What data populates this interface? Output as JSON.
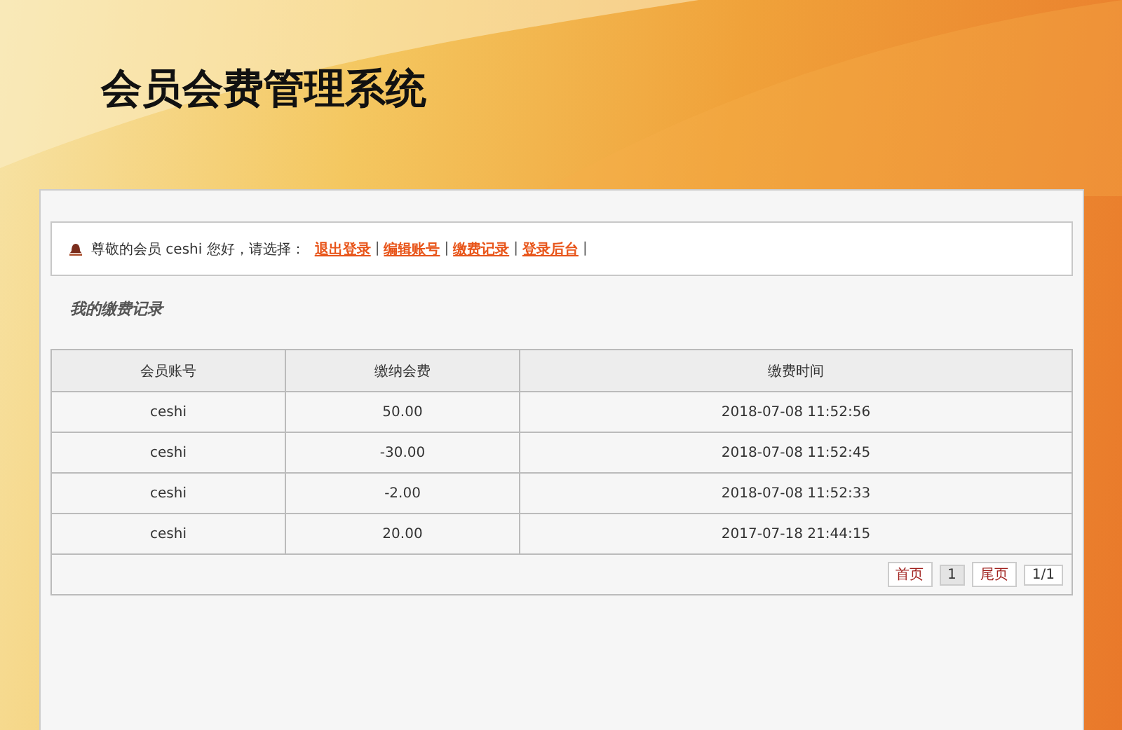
{
  "header": {
    "title": "会员会费管理系统"
  },
  "notice": {
    "greeting": "尊敬的会员 ceshi 您好，请选择：",
    "separator": "|",
    "links": [
      "退出登录",
      "编辑账号",
      "缴费记录",
      "登录后台"
    ]
  },
  "section_title": "我的缴费记录",
  "table": {
    "columns": [
      "会员账号",
      "缴纳会费",
      "缴费时间"
    ],
    "rows": [
      [
        "ceshi",
        "50.00",
        "2018-07-08 11:52:56"
      ],
      [
        "ceshi",
        "-30.00",
        "2018-07-08 11:52:45"
      ],
      [
        "ceshi",
        "-2.00",
        "2018-07-08 11:52:33"
      ],
      [
        "ceshi",
        "20.00",
        "2017-07-18 21:44:15"
      ]
    ]
  },
  "pager": [
    {
      "label": "首页",
      "kind": "link",
      "selected": false
    },
    {
      "label": "1",
      "kind": "page",
      "selected": true
    },
    {
      "label": "尾页",
      "kind": "link",
      "selected": false
    },
    {
      "label": "1/1",
      "kind": "info",
      "selected": false
    }
  ]
}
